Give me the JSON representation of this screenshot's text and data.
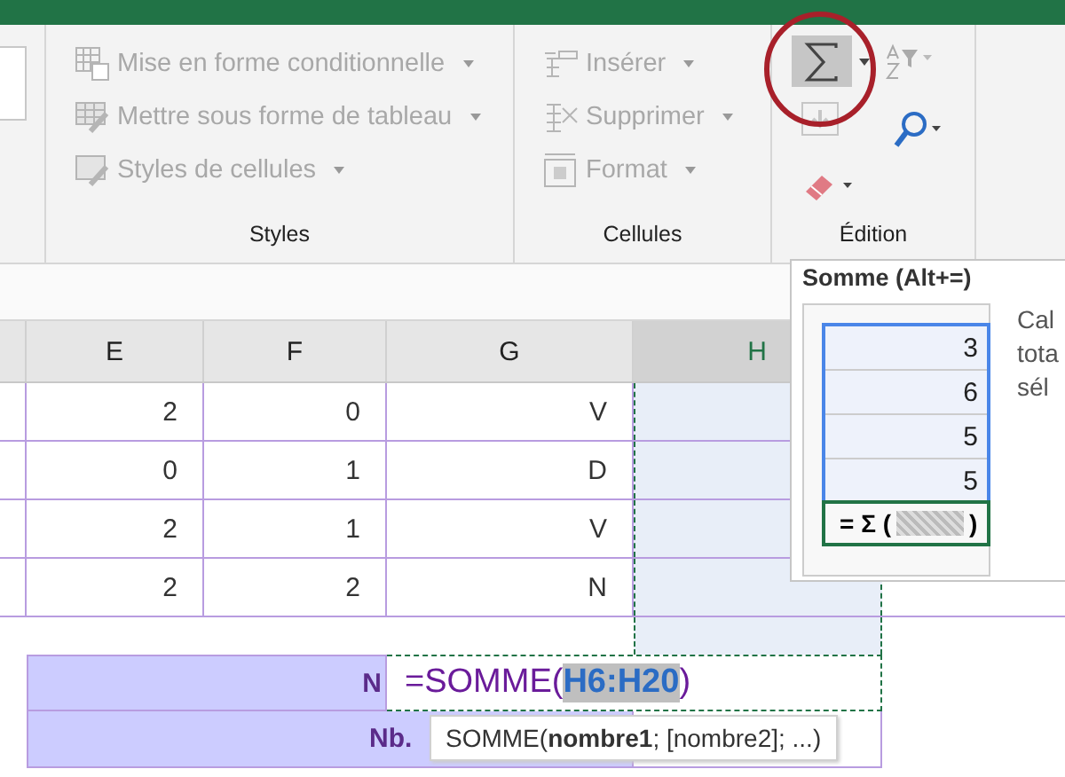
{
  "ribbon": {
    "groups": [
      {
        "label": "Styles",
        "items": [
          {
            "kind": "conditional",
            "label": "Mise en forme conditionnelle",
            "disabled": true
          },
          {
            "kind": "table",
            "label": "Mettre sous forme de tableau",
            "disabled": true
          },
          {
            "kind": "styles",
            "label": "Styles de cellules",
            "disabled": true
          }
        ]
      },
      {
        "label": "Cellules",
        "items": [
          {
            "kind": "insert",
            "label": "Insérer",
            "disabled": true
          },
          {
            "kind": "delete",
            "label": "Supprimer",
            "disabled": true
          },
          {
            "kind": "format",
            "label": "Format",
            "disabled": true
          }
        ]
      },
      {
        "label": "Édition"
      }
    ]
  },
  "sheet": {
    "columns": [
      {
        "label": "E",
        "selected": false
      },
      {
        "label": "F",
        "selected": false
      },
      {
        "label": "G",
        "selected": false
      },
      {
        "label": "H",
        "selected": true
      }
    ],
    "rows": [
      {
        "cells": [
          "2",
          "0",
          "V"
        ]
      },
      {
        "cells": [
          "0",
          "1",
          "D"
        ]
      },
      {
        "cells": [
          "2",
          "1",
          "V"
        ]
      },
      {
        "cells": [
          "2",
          "2",
          "N"
        ]
      }
    ],
    "summary": {
      "title_visible": "N",
      "formula_prefix": "=SOMME(",
      "formula_reference": "H6:H20",
      "formula_suffix": ")",
      "second_label_visible": "Nb.",
      "hint": "SOMME(**nombre1**; [nombre2]; ...)"
    }
  },
  "tooltip": {
    "title": "Somme (Alt+=)",
    "preview_values": [
      "3",
      "6",
      "5",
      "5"
    ],
    "preview_formula_left": "= Σ (",
    "preview_formula_right": ")",
    "description_lines": [
      "Cal",
      "tota",
      "sél"
    ]
  }
}
